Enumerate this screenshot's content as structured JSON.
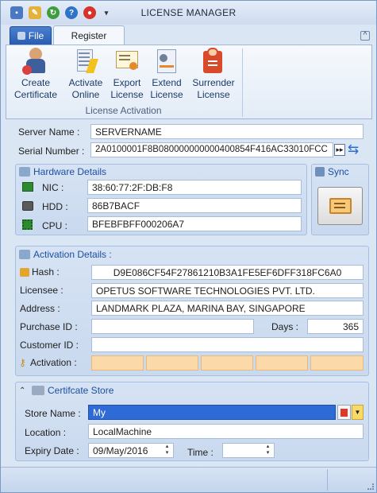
{
  "window": {
    "title": "LICENSE MANAGER"
  },
  "qat": [
    "save-icon",
    "clear-icon",
    "refresh-icon",
    "help-icon",
    "flag-icon",
    "customize-icon"
  ],
  "tabs": {
    "file": "File",
    "register": "Register"
  },
  "ribbon": {
    "buttons": [
      {
        "line1": "Create",
        "line2": "Certificate",
        "icon": "create-certificate-icon"
      },
      {
        "line1": "Activate",
        "line2": "Online",
        "icon": "activate-online-icon"
      },
      {
        "line1": "Export",
        "line2": "License",
        "icon": "export-license-icon"
      },
      {
        "line1": "Extend",
        "line2": "License",
        "icon": "extend-license-icon"
      },
      {
        "line1": "Surrender",
        "line2": "License",
        "icon": "surrender-license-icon"
      }
    ],
    "group_label": "License Activation"
  },
  "server": {
    "name_label": "Server Name :",
    "name_value": "SERVERNAME",
    "serial_label": "Serial Number :",
    "serial_value": "2A0100001F8B080000000000400854F416AC33010FCC"
  },
  "hardware": {
    "title": "Hardware Details",
    "nic_label": "NIC :",
    "nic_value": "38:60:77:2F:DB:F8",
    "hdd_label": "HDD :",
    "hdd_value": "86B7BACF",
    "cpu_label": "CPU :",
    "cpu_value": "BFEBFBFF000206A7"
  },
  "sync": {
    "title": "Sync"
  },
  "activation": {
    "title": "Activation Details :",
    "hash_label": "Hash :",
    "hash_value": "D9E086CF54F27861210B3A1FE5EF6DFF318FC6A0",
    "licensee_label": "Licensee :",
    "licensee_value": "OPETUS SOFTWARE TECHNOLOGIES PVT. LTD.",
    "address_label": "Address :",
    "address_value": "LANDMARK PLAZA, MARINA BAY, SINGAPORE",
    "purchase_label": "Purchase ID :",
    "purchase_value": "",
    "days_label": "Days :",
    "days_value": "365",
    "customer_label": "Customer ID :",
    "customer_value": "",
    "activation_label": "Activation :",
    "activation_accent": "#fcd9a8"
  },
  "store": {
    "title": "Certifcate Store",
    "store_name_label": "Store Name :",
    "store_name_value": "My",
    "location_label": "Location :",
    "location_value": "LocalMachine",
    "expiry_label": "Expiry Date :",
    "expiry_value": "09/May/2016",
    "time_label": "Time :",
    "time_value": ""
  },
  "colors": {
    "accent": "#1c4ea0",
    "selection": "#2f6bd6",
    "window_bg": "#dbe6f4"
  }
}
